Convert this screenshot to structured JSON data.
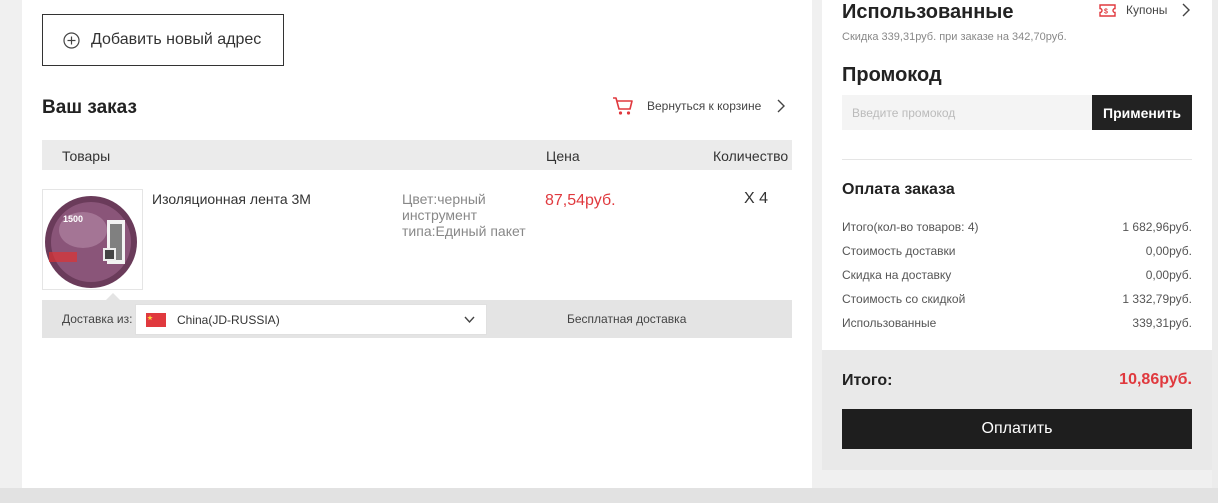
{
  "address": {
    "add_label": "Добавить новый адрес"
  },
  "order": {
    "title": "Ваш заказ",
    "back_to_cart": "Вернуться к корзине",
    "columns": {
      "goods": "Товары",
      "price": "Цена",
      "qty": "Количество"
    },
    "item": {
      "name": "Изоляционная лента 3M",
      "attrs": "Цвет:черный инструмент типа:Единый пакет",
      "price": "87,54руб.",
      "qty": "X 4",
      "thumb_text": "1500"
    },
    "delivery": {
      "from_label": "Доставка из:",
      "from_value": "China(JD-RUSSIA)",
      "free_label": "Бесплатная доставка"
    }
  },
  "coupons": {
    "title": "Использованные",
    "link": "Купоны",
    "note": "Скидка 339,31руб. при заказе на 342,70руб."
  },
  "promo": {
    "title": "Промокод",
    "placeholder": "Введите промокод",
    "apply": "Применить"
  },
  "payment": {
    "title": "Оплата заказа",
    "rows": [
      {
        "label": "Итого(кол-во товаров: 4)",
        "value": "1 682,96руб."
      },
      {
        "label": "Стоимость доставки",
        "value": "0,00руб."
      },
      {
        "label": "Скидка на доставку",
        "value": "0,00руб."
      },
      {
        "label": "Стоимость со скидкой",
        "value": "1 332,79руб."
      },
      {
        "label": "Использованные",
        "value": "339,31руб."
      }
    ],
    "total_label": "Итого:",
    "total_value": "10,86руб.",
    "pay_button": "Оплатить"
  },
  "colors": {
    "accent": "#e0393e",
    "dark_button": "#222222"
  },
  "icons": {
    "add": "plus-circle-icon",
    "cart": "cart-icon",
    "coupon": "ticket-icon",
    "flag": "china-flag-icon",
    "chevron": "chevron-right-icon",
    "dropdown": "chevron-down-icon"
  }
}
